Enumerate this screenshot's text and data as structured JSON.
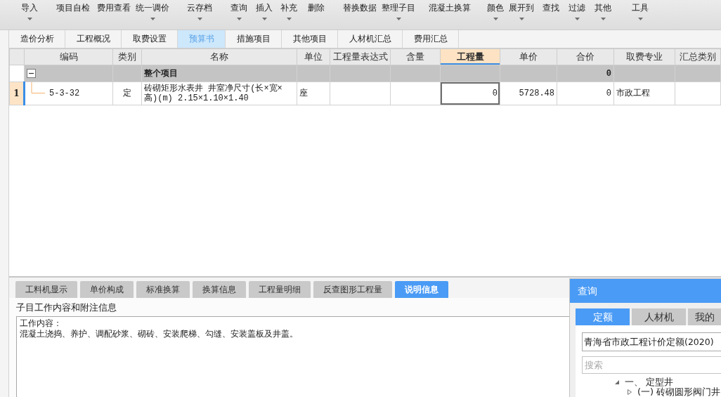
{
  "toolbar": [
    {
      "label": "导入",
      "dropdown": true
    },
    {
      "label": "项目自检",
      "dropdown": false
    },
    {
      "label": "费用查看",
      "dropdown": false
    },
    {
      "label": "统一调价",
      "dropdown": true
    },
    {
      "label": "云存档",
      "dropdown": true
    },
    {
      "label": "查询",
      "dropdown": true
    },
    {
      "label": "插入",
      "dropdown": true
    },
    {
      "label": "补充",
      "dropdown": true
    },
    {
      "label": "删除",
      "dropdown": false
    },
    {
      "label": "替换数据",
      "dropdown": false
    },
    {
      "label": "整理子目",
      "dropdown": true
    },
    {
      "label": "混凝土换算",
      "dropdown": false
    },
    {
      "label": "颜色",
      "dropdown": true
    },
    {
      "label": "展开到",
      "dropdown": true
    },
    {
      "label": "查找",
      "dropdown": false
    },
    {
      "label": "过滤",
      "dropdown": true
    },
    {
      "label": "其他",
      "dropdown": true
    },
    {
      "label": "工具",
      "dropdown": true
    }
  ],
  "view_tabs": [
    {
      "label": "造价分析",
      "selected": false
    },
    {
      "label": "工程概况",
      "selected": false
    },
    {
      "label": "取费设置",
      "selected": false
    },
    {
      "label": "预算书",
      "selected": true
    },
    {
      "label": "措施项目",
      "selected": false
    },
    {
      "label": "其他项目",
      "selected": false
    },
    {
      "label": "人材机汇总",
      "selected": false
    },
    {
      "label": "费用汇总",
      "selected": false
    }
  ],
  "table": {
    "columns": [
      {
        "label": "编码",
        "highlighted": false
      },
      {
        "label": "类别",
        "highlighted": false
      },
      {
        "label": "名称",
        "highlighted": false
      },
      {
        "label": "单位",
        "highlighted": false
      },
      {
        "label": "工程量表达式",
        "highlighted": false
      },
      {
        "label": "含量",
        "highlighted": false
      },
      {
        "label": "工程量",
        "highlighted": true
      },
      {
        "label": "单价",
        "highlighted": false
      },
      {
        "label": "合价",
        "highlighted": false
      },
      {
        "label": "取费专业",
        "highlighted": false
      },
      {
        "label": "汇总类别",
        "highlighted": false
      }
    ],
    "rows": [
      {
        "kind": "group",
        "selected": false,
        "expanded": true,
        "name": "整个项目",
        "total": "0"
      },
      {
        "kind": "item",
        "selected": true,
        "number": "1",
        "code": "5-3-32",
        "type": "定",
        "name": "砖砌矩形水表井 井室净尺寸(长×宽×高)(m) 2.15×1.10×1.40",
        "unit": "座",
        "quantity": "0",
        "unit_price": "5728.48",
        "total": "0",
        "fee_category": "市政工程"
      }
    ]
  },
  "detail_tabs": [
    {
      "label": "工料机显示",
      "selected": false
    },
    {
      "label": "单价构成",
      "selected": false
    },
    {
      "label": "标准换算",
      "selected": false
    },
    {
      "label": "换算信息",
      "selected": false
    },
    {
      "label": "工程量明细",
      "selected": false
    },
    {
      "label": "反查图形工程量",
      "selected": false
    },
    {
      "label": "说明信息",
      "selected": true
    }
  ],
  "detail": {
    "title": "子目工作内容和附注信息",
    "lines": [
      "工作内容：",
      "混凝土浇捣、养护、调配砂浆、砌砖、安装爬梯、勾缝、安装盖板及井盖。"
    ]
  },
  "query_panel": {
    "title": "查询",
    "tabs": [
      {
        "label": "定额",
        "selected": true
      },
      {
        "label": "人材机",
        "selected": false
      },
      {
        "label": "我的",
        "selected": false
      }
    ],
    "library": "青海省市政工程计价定额(2020)",
    "search": {
      "placeholder": "搜索"
    },
    "tree": [
      {
        "label": "一、 定型井",
        "expanded": true,
        "children": [
          {
            "label": "(一) 砖砌圆形阀门井",
            "expanded": false
          }
        ]
      }
    ]
  }
}
